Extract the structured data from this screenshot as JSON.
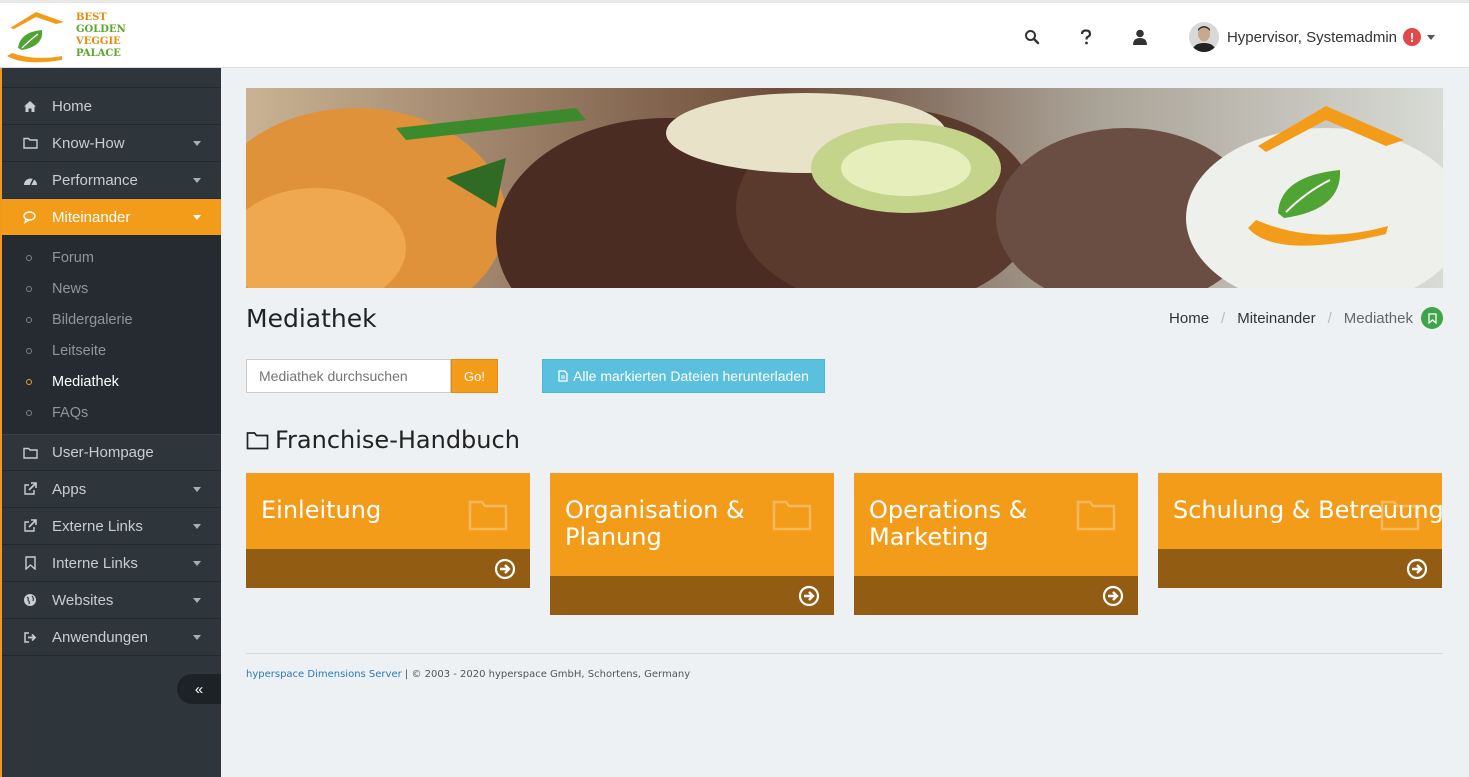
{
  "brand": {
    "logo_lines": [
      "BEST",
      "GOLDEN",
      "VEGGIE",
      "PALACE"
    ],
    "orange": "#f39c1a",
    "green": "#4fa433",
    "dark_brown": "#925d12"
  },
  "header": {
    "icons": [
      "search-icon",
      "help-icon",
      "user-icon"
    ],
    "user_name": "Hypervisor, Systemadmin",
    "alert": "!"
  },
  "sidebar": {
    "items": [
      {
        "label": "Home",
        "icon": "home-icon"
      },
      {
        "label": "Know-How",
        "icon": "folder-icon"
      },
      {
        "label": "Performance",
        "icon": "dashboard-icon"
      },
      {
        "label": "Miteinander",
        "icon": "comments-icon"
      },
      {
        "label": "User-Hompage",
        "icon": "folder-icon"
      },
      {
        "label": "Apps",
        "icon": "external-link-icon"
      },
      {
        "label": "Externe Links",
        "icon": "external-link-icon"
      },
      {
        "label": "Interne Links",
        "icon": "bookmark-icon"
      },
      {
        "label": "Websites",
        "icon": "globe-icon"
      },
      {
        "label": "Anwendungen",
        "icon": "sign-out-icon"
      }
    ],
    "subitems": [
      "Forum",
      "News",
      "Bildergalerie",
      "Leitseite",
      "Mediathek",
      "FAQs"
    ],
    "collapse": "«"
  },
  "page": {
    "title": "Mediathek",
    "breadcrumb": [
      "Home",
      "Miteinander",
      "Mediathek"
    ]
  },
  "toolbar": {
    "search_placeholder": "Mediathek durchsuchen",
    "go_label": "Go!",
    "download_label": "Alle markierten Dateien herunterladen"
  },
  "section": {
    "title": "Franchise-Handbuch",
    "tiles": [
      {
        "label": "Einleitung"
      },
      {
        "label": "Organisation & Planung"
      },
      {
        "label": "Operations & Marketing"
      },
      {
        "label": "Schulung & Betreuung"
      }
    ]
  },
  "footer": {
    "link": "hyperspace Dimensions Server",
    "text": " | © 2003 - 2020 hyperspace GmbH, Schortens, Germany"
  }
}
